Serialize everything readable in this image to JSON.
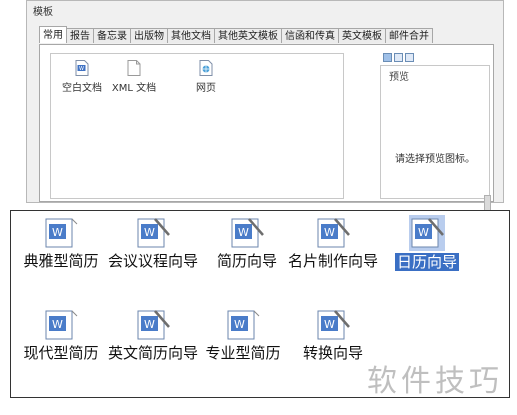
{
  "dialog": {
    "title": "模板",
    "tabs": [
      {
        "label": "常用",
        "active": true
      },
      {
        "label": "报告",
        "active": false
      },
      {
        "label": "备忘录",
        "active": false
      },
      {
        "label": "出版物",
        "active": false
      },
      {
        "label": "其他文档",
        "active": false
      },
      {
        "label": "其他英文模板",
        "active": false
      },
      {
        "label": "信函和传真",
        "active": false
      },
      {
        "label": "英文模板",
        "active": false
      },
      {
        "label": "邮件合并",
        "active": false
      }
    ],
    "files": [
      {
        "label": "空白文档",
        "icon": "word-doc-icon"
      },
      {
        "label": "XML 文档",
        "icon": "xml-doc-icon"
      },
      {
        "label": "网页",
        "icon": "web-page-icon"
      }
    ],
    "preview": {
      "label": "预览",
      "message": "请选择预览图标。"
    }
  },
  "templates": [
    {
      "label": "典雅型简历",
      "selected": false
    },
    {
      "label": "会议议程向导",
      "selected": false
    },
    {
      "label": "简历向导",
      "selected": false
    },
    {
      "label": "名片制作向导",
      "selected": false
    },
    {
      "label": "日历向导",
      "selected": true
    },
    {
      "label": "现代型简历",
      "selected": false
    },
    {
      "label": "英文简历向导",
      "selected": false
    },
    {
      "label": "专业型简历",
      "selected": false
    },
    {
      "label": "转换向导",
      "selected": false
    }
  ],
  "watermark": "软件技巧",
  "colors": {
    "selection": "#3a6fc4",
    "icon_blue": "#4a7cc9"
  }
}
